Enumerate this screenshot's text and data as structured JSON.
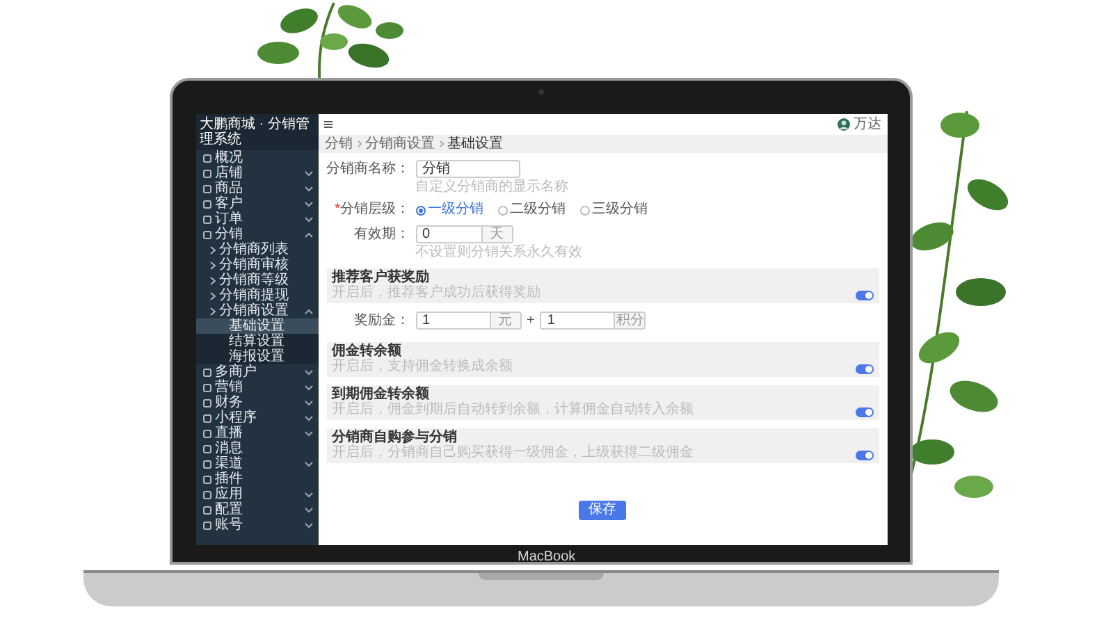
{
  "laptop": {
    "label": "MacBook"
  },
  "sidebar": {
    "title": "大鹏商城 · 分销管理系统",
    "items": [
      {
        "label": "概况"
      },
      {
        "label": "店铺",
        "expanded": false
      },
      {
        "label": "商品",
        "expanded": false
      },
      {
        "label": "客户",
        "expanded": false
      },
      {
        "label": "订单",
        "expanded": false
      },
      {
        "label": "分销",
        "expanded": true,
        "children": [
          {
            "label": "分销商列表"
          },
          {
            "label": "分销商审核"
          },
          {
            "label": "分销商等级"
          },
          {
            "label": "分销商提现"
          },
          {
            "label": "分销商设置",
            "expanded": true,
            "children": [
              {
                "label": "基础设置",
                "selected": true
              },
              {
                "label": "结算设置",
                "selected": false
              },
              {
                "label": "海报设置",
                "selected": false
              }
            ]
          }
        ]
      },
      {
        "label": "多商户",
        "expanded": false
      },
      {
        "label": "营销",
        "expanded": false
      },
      {
        "label": "财务",
        "expanded": false
      },
      {
        "label": "小程序",
        "expanded": false
      },
      {
        "label": "直播",
        "expanded": false
      },
      {
        "label": "消息"
      },
      {
        "label": "渠道",
        "expanded": false
      },
      {
        "label": "插件"
      },
      {
        "label": "应用",
        "expanded": false
      },
      {
        "label": "配置",
        "expanded": false
      },
      {
        "label": "账号",
        "expanded": false
      }
    ]
  },
  "topbar": {
    "user": "万达"
  },
  "breadcrumb": [
    "分销",
    "分销商设置",
    "基础设置"
  ],
  "form": {
    "name": {
      "label": "分销商名称：",
      "value": "分销",
      "hint": "自定义分销商的显示名称"
    },
    "level": {
      "label": "分销层级：",
      "required_mark": "*",
      "options": [
        {
          "label": "一级分销",
          "selected": true
        },
        {
          "label": "二级分销",
          "selected": false
        },
        {
          "label": "三级分销",
          "selected": false
        }
      ]
    },
    "validity": {
      "label": "有效期：",
      "value": "0",
      "unit": "天",
      "hint": "不设置则分销关系永久有效"
    }
  },
  "sections": [
    {
      "title": "推荐客户获奖励",
      "description": "开启后，推荐客户成功后获得奖励",
      "on": true,
      "reward": {
        "label": "奖励金：",
        "money": "1",
        "money_unit": "元",
        "plus": "+",
        "points": "1",
        "points_unit": "积分"
      }
    },
    {
      "title": "佣金转余额",
      "description": "开启后，支持佣金转换成余额",
      "on": true
    },
    {
      "title": "到期佣金转余额",
      "description": "开启后，佣金到期后自动转到余额，计算佣金自动转入余额",
      "on": true
    },
    {
      "title": "分销商自购参与分销",
      "description": "开启后，分销商自己购买获得一级佣金，上级获得二级佣金",
      "on": true
    }
  ],
  "save_button": "保存"
}
